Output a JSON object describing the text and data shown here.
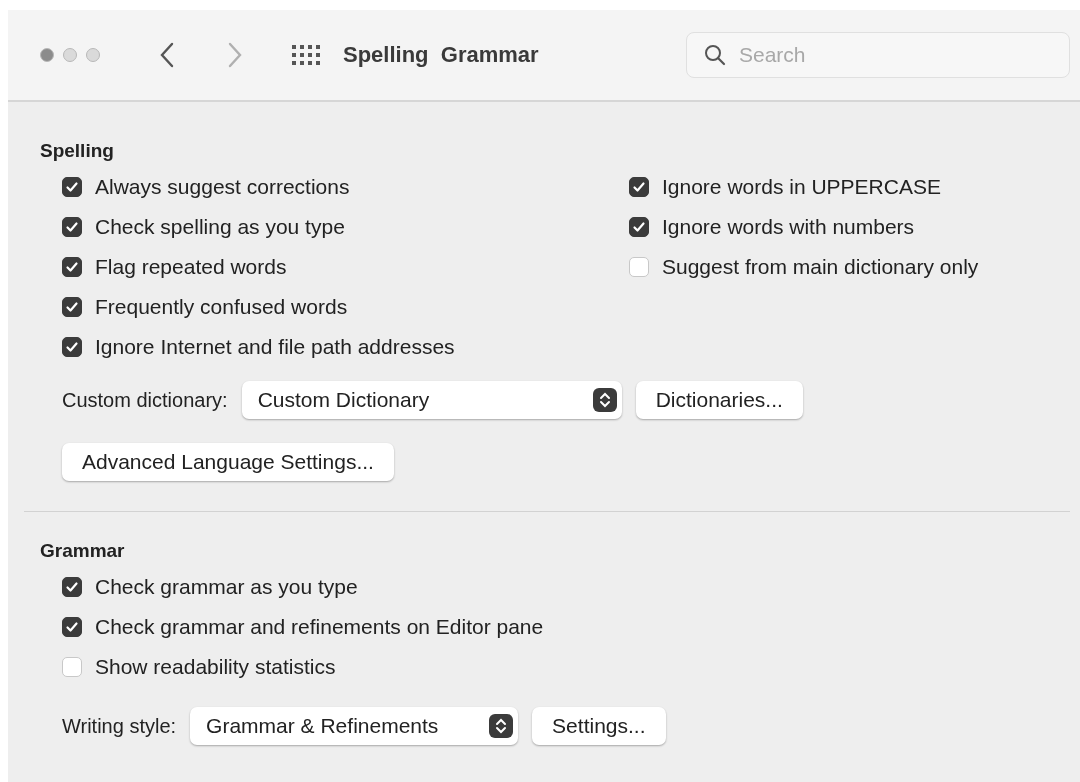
{
  "window": {
    "title": "Spelling  Grammar"
  },
  "toolbar": {
    "back": {
      "disabled": false
    },
    "forward": {
      "disabled": true
    },
    "search": {
      "placeholder": "Search"
    }
  },
  "spelling": {
    "heading": "Spelling",
    "left_options": [
      {
        "label": "Always suggest corrections",
        "checked": true
      },
      {
        "label": "Check spelling as you type",
        "checked": true
      },
      {
        "label": "Flag repeated words",
        "checked": true
      },
      {
        "label": "Frequently confused words",
        "checked": true
      },
      {
        "label": "Ignore Internet and file path addresses",
        "checked": true
      }
    ],
    "right_options": [
      {
        "label": "Ignore words in UPPERCASE",
        "checked": true
      },
      {
        "label": "Ignore words with numbers",
        "checked": true
      },
      {
        "label": "Suggest from main dictionary only",
        "checked": false
      }
    ],
    "custom_dictionary": {
      "label": "Custom dictionary:",
      "value": "Custom Dictionary",
      "button": "Dictionaries..."
    },
    "advanced_button": "Advanced Language Settings..."
  },
  "grammar": {
    "heading": "Grammar",
    "options": [
      {
        "label": "Check grammar as you type",
        "checked": true
      },
      {
        "label": "Check grammar and refinements on Editor pane",
        "checked": true
      },
      {
        "label": "Show readability statistics",
        "checked": false
      }
    ],
    "writing_style": {
      "label": "Writing style:",
      "value": "Grammar & Refinements",
      "button": "Settings..."
    }
  }
}
